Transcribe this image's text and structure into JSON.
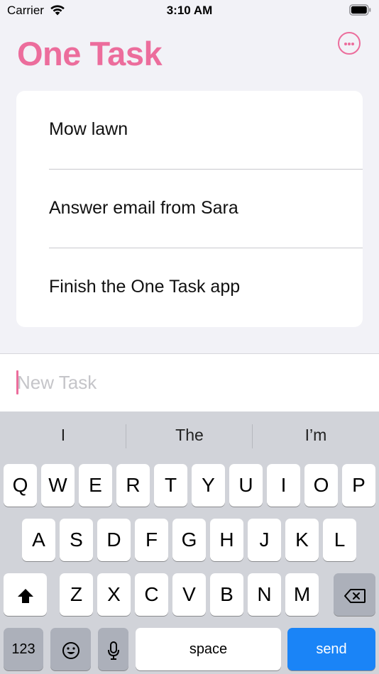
{
  "status_bar": {
    "carrier": "Carrier",
    "time": "3:10 AM",
    "wifi_icon": "wifi-icon",
    "battery_icon": "battery-icon"
  },
  "header": {
    "title": "One Task",
    "more_icon": "ellipsis-circle-icon",
    "accent_color": "#ec6d9c"
  },
  "tasks": [
    {
      "label": "Mow lawn"
    },
    {
      "label": "Answer email from Sara"
    },
    {
      "label": "Finish the One Task app"
    }
  ],
  "input": {
    "value": "",
    "placeholder": "New Task"
  },
  "keyboard": {
    "suggestions": [
      "I",
      "The",
      "I’m"
    ],
    "row1": [
      "Q",
      "W",
      "E",
      "R",
      "T",
      "Y",
      "U",
      "I",
      "O",
      "P"
    ],
    "row2": [
      "A",
      "S",
      "D",
      "F",
      "G",
      "H",
      "J",
      "K",
      "L"
    ],
    "row3": [
      "Z",
      "X",
      "C",
      "V",
      "B",
      "N",
      "M"
    ],
    "numbers_label": "123",
    "space_label": "space",
    "send_label": "send",
    "send_color": "#1a84f7",
    "shift_icon": "shift-icon",
    "backspace_icon": "backspace-icon",
    "emoji_icon": "emoji-icon",
    "mic_icon": "microphone-icon"
  }
}
